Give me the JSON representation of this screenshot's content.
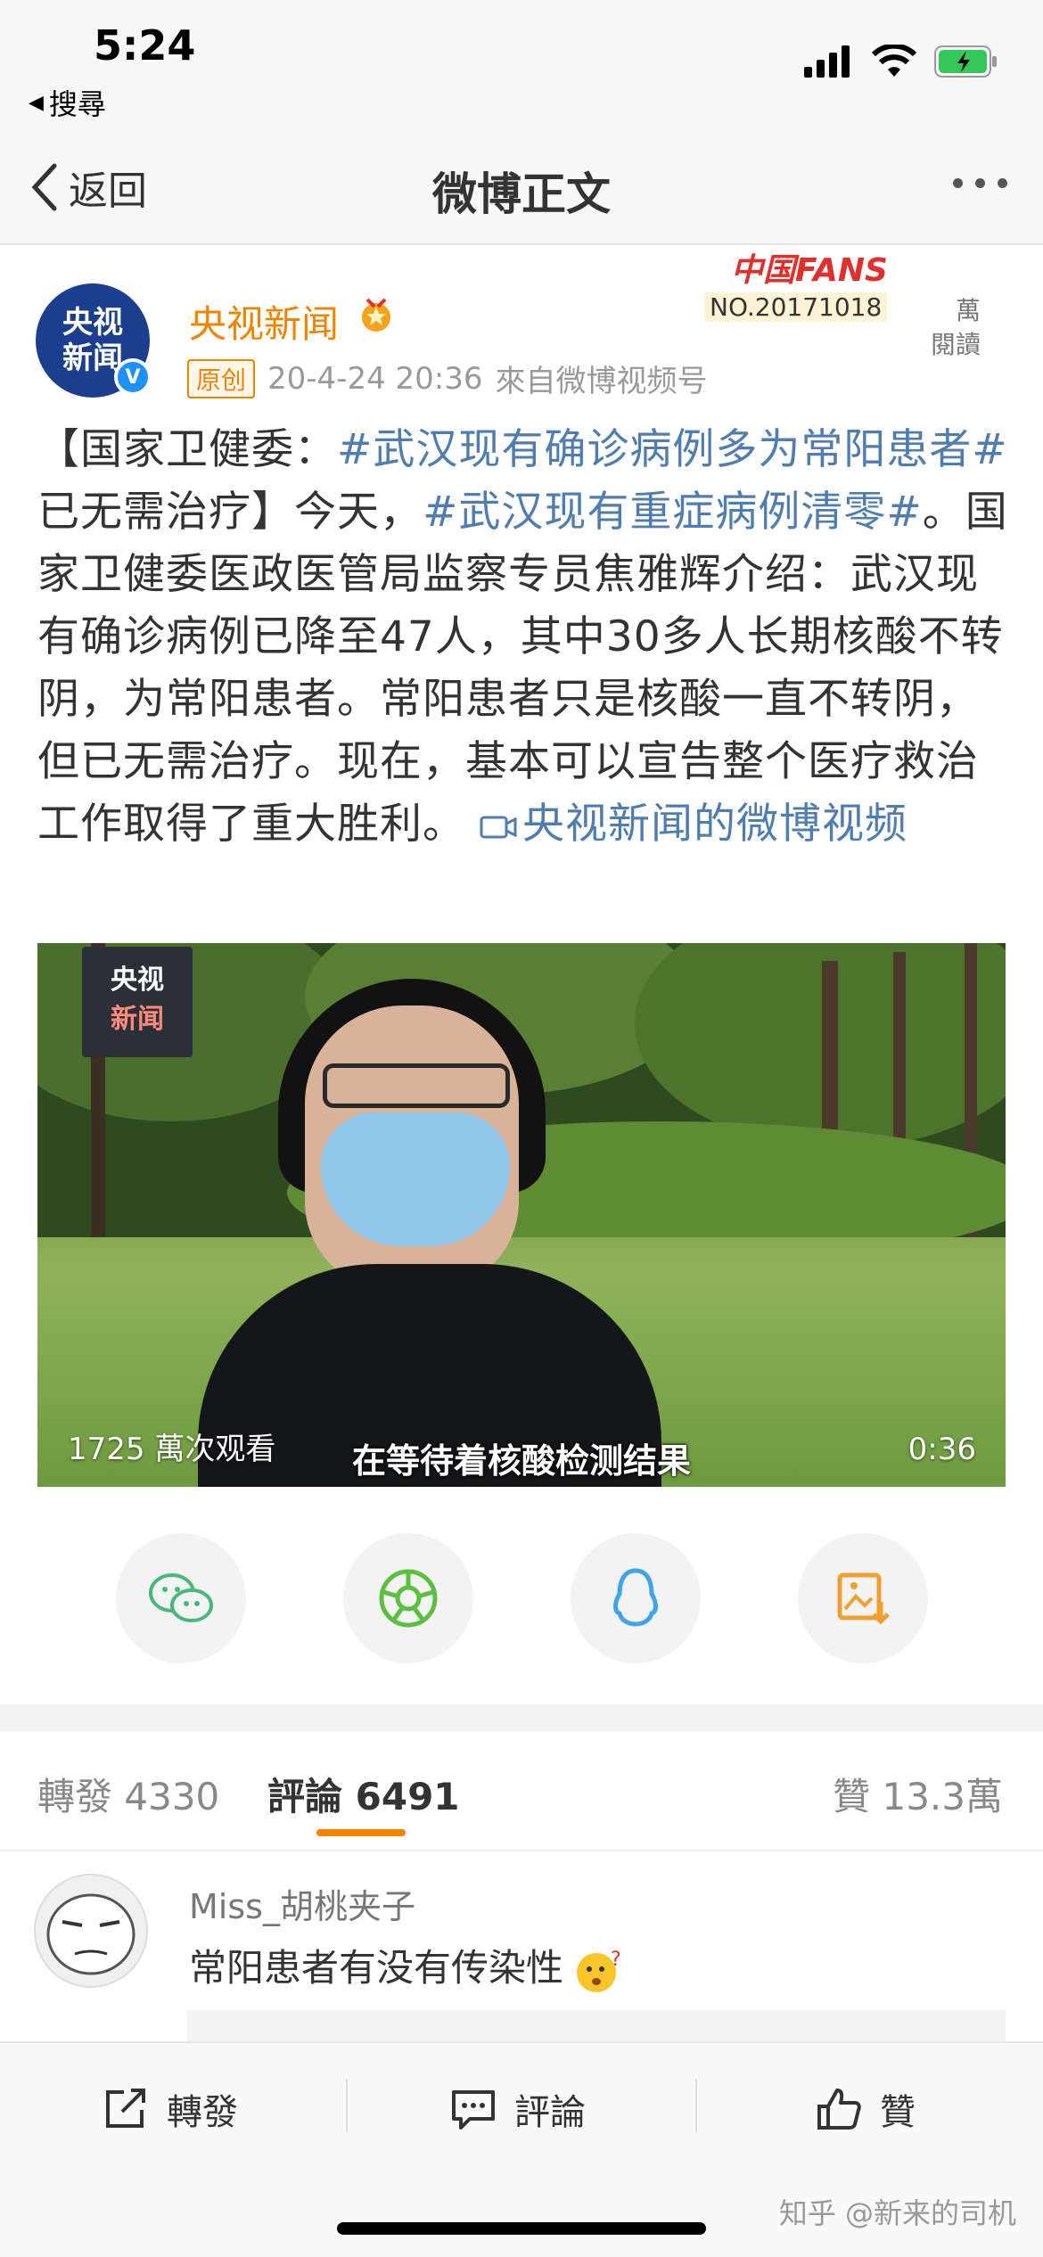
{
  "status_bar": {
    "time": "5:24",
    "back_app": "搜尋"
  },
  "nav": {
    "back_label": "返回",
    "title": "微博正文"
  },
  "post": {
    "author_avatar_text": "央视新闻",
    "author_name": "央视新闻",
    "original_tag": "原创",
    "timestamp": "20-4-24 20:36",
    "source_prefix": "來自",
    "source": "微博视频号",
    "fans_badge_title": "中国FANS",
    "fans_badge_number": "NO.20171018",
    "reads_count": "萬",
    "reads_label": "閱讀",
    "text_parts": {
      "p1": "【国家卫健委：",
      "topic1": "#武汉现有确诊病例多为常阳患者#",
      "p2": " 已无需治疗】今天，",
      "topic2": "#武汉现有重症病例清零#",
      "p3": "。国家卫健委医政医管局监察专员焦雅辉介绍：武汉现有确诊病例已降至47人，其中30多人长期核酸不转阴，为常阳患者。常阳患者只是核酸一直不转阴，但已无需治疗。现在，基本可以宣告整个医疗救治工作取得了重大胜利。 ",
      "video_link": "央视新闻的微博视频"
    },
    "video": {
      "logo_line1": "央视",
      "logo_line2": "新闻",
      "views": "1725 萬次观看",
      "caption": "在等待着核酸检测结果",
      "duration": "0:36"
    }
  },
  "share_icons": [
    "wechat-icon",
    "moments-icon",
    "qq-icon",
    "save-image-icon"
  ],
  "tabs": {
    "repost_label": "轉發",
    "repost_count": "4330",
    "comment_label": "評論",
    "comment_count": "6491",
    "like_label": "贊",
    "like_count": "13.3萬"
  },
  "comment": {
    "user": "Miss_胡桃夹子",
    "text": "常阳患者有没有传染性"
  },
  "bottom_bar": {
    "repost": "轉發",
    "comment": "評論",
    "like": "贊"
  },
  "watermark": "知乎 @新来的司机",
  "colors": {
    "accent_orange": "#f08300",
    "link_blue": "#507daf"
  }
}
